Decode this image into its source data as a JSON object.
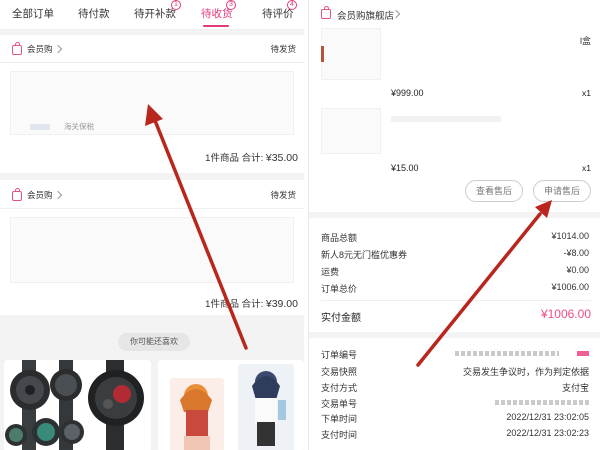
{
  "left": {
    "tabs": [
      {
        "label": "全部订单",
        "active": false,
        "badge": ""
      },
      {
        "label": "待付款",
        "active": false,
        "badge": ""
      },
      {
        "label": "待开补款",
        "active": false,
        "badge": "1"
      },
      {
        "label": "待收货",
        "active": true,
        "badge": "3"
      },
      {
        "label": "待评价",
        "active": false,
        "badge": "4"
      }
    ],
    "orders": [
      {
        "shop_name": "会员购",
        "status": "待发货",
        "item_text": "海关保税",
        "summary": "1件商品 合计:",
        "total": "¥35.00"
      },
      {
        "shop_name": "会员购",
        "status": "待发货",
        "summary": "1件商品 合计:",
        "total": "¥39.00"
      }
    ],
    "recommend_label": "你可能还喜欢"
  },
  "right": {
    "shop_name": "会员购旗舰店",
    "items": [
      {
        "title_tail": "l盒",
        "price": "¥999.00",
        "qty": "x1"
      },
      {
        "price": "¥15.00",
        "qty": "x1"
      }
    ],
    "buttons": {
      "view_after_sale": "查看售后",
      "apply_after_sale": "申请售后"
    },
    "summary": [
      {
        "label": "商品总额",
        "value": "¥1014.00"
      },
      {
        "label": "新人8元无门槛优惠券",
        "value": "-¥8.00"
      },
      {
        "label": "运费",
        "value": "¥0.00"
      },
      {
        "label": "订单总价",
        "value": "¥1006.00"
      }
    ],
    "paid": {
      "label": "实付金额",
      "value": "¥1006.00"
    },
    "info": [
      {
        "label": "订单编号",
        "value": ""
      },
      {
        "label": "交易快照",
        "value": "交易发生争议时，作为判定依据"
      },
      {
        "label": "支付方式",
        "value": "支付宝"
      },
      {
        "label": "交易单号",
        "value": ""
      },
      {
        "label": "下单时间",
        "value": "2022/12/31 23:02:05"
      },
      {
        "label": "支付时间",
        "value": "2022/12/31 23:02:23"
      }
    ]
  },
  "colors": {
    "accent": "#e23a7c",
    "price_pink": "#f04b88",
    "arrow": "#b8261e"
  }
}
